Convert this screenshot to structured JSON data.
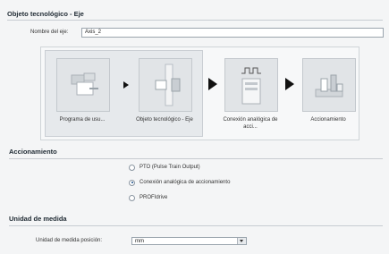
{
  "header": {
    "title": "Objeto tecnológico - Eje"
  },
  "axis_name": {
    "label": "Nombre del eje:",
    "value": "Axis_2"
  },
  "diagram": {
    "tiles": [
      {
        "label": "Programa de usu...",
        "icon": "program-icon"
      },
      {
        "label": "Objeto tecnológico - Eje",
        "icon": "technology-object-icon"
      },
      {
        "label": "Conexión analógica de acci...",
        "icon": "pulse-generator-icon"
      },
      {
        "label": "Accionamiento",
        "icon": "drive-motor-icon"
      }
    ]
  },
  "drive": {
    "title": "Accionamiento",
    "options": [
      {
        "label": "PTO (Pulse Train Output)",
        "selected": false
      },
      {
        "label": "Conexión analógica de accionamiento",
        "selected": true
      },
      {
        "label": "PROFIdrive",
        "selected": false
      }
    ]
  },
  "units": {
    "title": "Unidad de medida",
    "position_label": "Unidad de medida posición:",
    "position_value": "mm"
  },
  "colors": {
    "accent_radio": "#1a4f8a",
    "border": "#9aa4ad"
  }
}
